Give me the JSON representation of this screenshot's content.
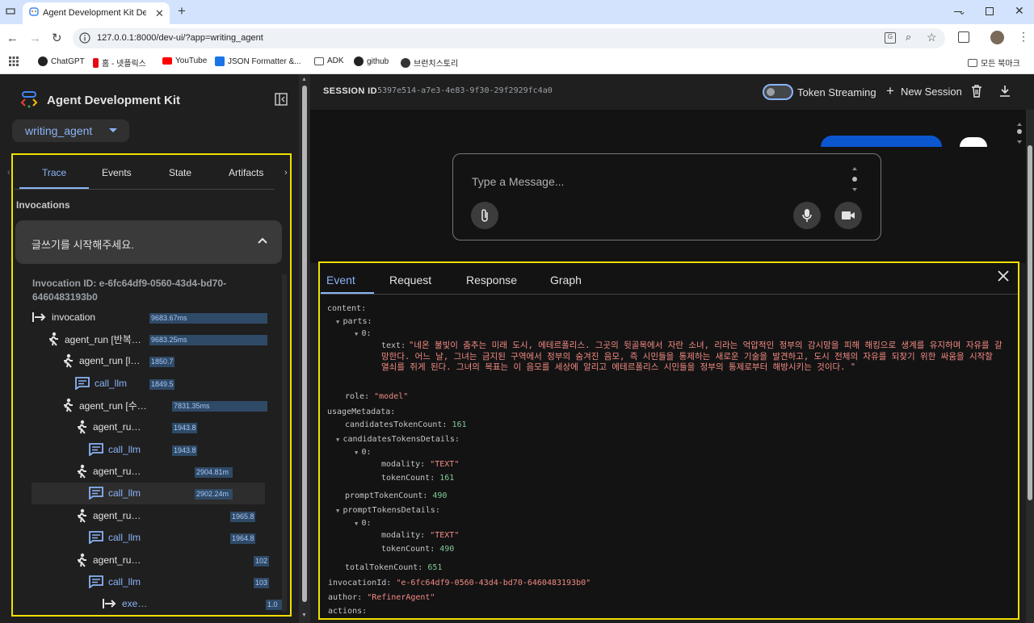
{
  "browser": {
    "tab_title": "Agent Development Kit Dev U",
    "url": "127.0.0.1:8000/dev-ui/?app=writing_agent",
    "bookmarks": [
      "ChatGPT",
      "홈 - 넷플릭스",
      "YouTube",
      "JSON Formatter &...",
      "ADK",
      "github",
      "브런치스토리"
    ],
    "all_bookmarks": "모든 북마크"
  },
  "sidebar": {
    "brand": "Agent Development Kit",
    "app_name": "writing_agent",
    "tabs": [
      "Trace",
      "Events",
      "State",
      "Artifacts"
    ],
    "invocations_label": "Invocations",
    "invocation_title": "글쓰기를 시작해주세요.",
    "invocation_id": "Invocation ID: e-6fc64df9-0560-43d4-bd70-6460483193b0",
    "trace": [
      {
        "label": "invocation",
        "duration": "9683.67ms"
      },
      {
        "label": "agent_run [반복…",
        "duration": "9683.25ms"
      },
      {
        "label": "agent_run [l…",
        "duration": "1850.7"
      },
      {
        "label": "call_llm",
        "duration": "1849.5"
      },
      {
        "label": "agent_run [수…",
        "duration": "7831.35ms"
      },
      {
        "label": "agent_ru…",
        "duration": "1943.8"
      },
      {
        "label": "call_llm",
        "duration": "1943.8"
      },
      {
        "label": "agent_ru…",
        "duration": "2904.81m"
      },
      {
        "label": "call_llm",
        "duration": "2902.24m"
      },
      {
        "label": "agent_ru…",
        "duration": "1965.8"
      },
      {
        "label": "call_llm",
        "duration": "1964.8"
      },
      {
        "label": "agent_ru…",
        "duration": "102"
      },
      {
        "label": "call_llm",
        "duration": "103"
      },
      {
        "label": "exe…",
        "duration": "1.0"
      }
    ]
  },
  "session": {
    "label": "SESSION ID",
    "id": "5397e514-a7e3-4e83-9f30-29f2929fc4a0",
    "token_streaming": "Token Streaming",
    "new_session": "New Session"
  },
  "composer": {
    "placeholder": "Type a Message..."
  },
  "detail": {
    "tabs": [
      "Event",
      "Request",
      "Response",
      "Graph"
    ],
    "json": {
      "content_key": "content:",
      "parts_key": "parts:",
      "idx0": "0:",
      "text_key": "text:",
      "text_val": "\"네온 불빛이 춤추는 미래 도시, 에테르폴리스. 그곳의 뒷골목에서 자란 소녀, 리라는 억압적인 정부의 감시망을 피해 해킹으로 생계를 유지하며 자유를 갈망한다. 어느 날, 그녀는 금지된 구역에서 정부의 숨겨진 음모, 즉 시민들을 통제하는 새로운 기술을 발견하고, 도시 전체의 자유를 되찾기 위한 싸움을 시작할 열쇠를 쥐게 된다. 그녀의 목표는 이 음모를 세상에 알리고 에테르폴리스 시민들을 정부의 통제로부터 해방시키는 것이다. \"",
      "role_key": "role:",
      "role_val": "\"model\"",
      "usage_key": "usageMetadata:",
      "cand_count_key": "candidatesTokenCount:",
      "cand_count_val": "161",
      "cand_details_key": "candidatesTokensDetails:",
      "modality_key": "modality:",
      "modality_val": "\"TEXT\"",
      "token_count_key": "tokenCount:",
      "cand_token_count_val": "161",
      "prompt_count_key": "promptTokenCount:",
      "prompt_count_val": "490",
      "prompt_details_key": "promptTokensDetails:",
      "prompt_token_count_val": "490",
      "total_key": "totalTokenCount:",
      "total_val": "651",
      "invocation_key": "invocationId:",
      "invocation_val": "\"e-6fc64df9-0560-43d4-bd70-6460483193b0\"",
      "author_key": "author:",
      "author_val": "\"RefinerAgent\"",
      "actions_key": "actions:"
    }
  },
  "colors": {
    "accent": "#8ab4f8",
    "highlight": "#f0e000",
    "string": "#f28b82",
    "number": "#81c995"
  }
}
